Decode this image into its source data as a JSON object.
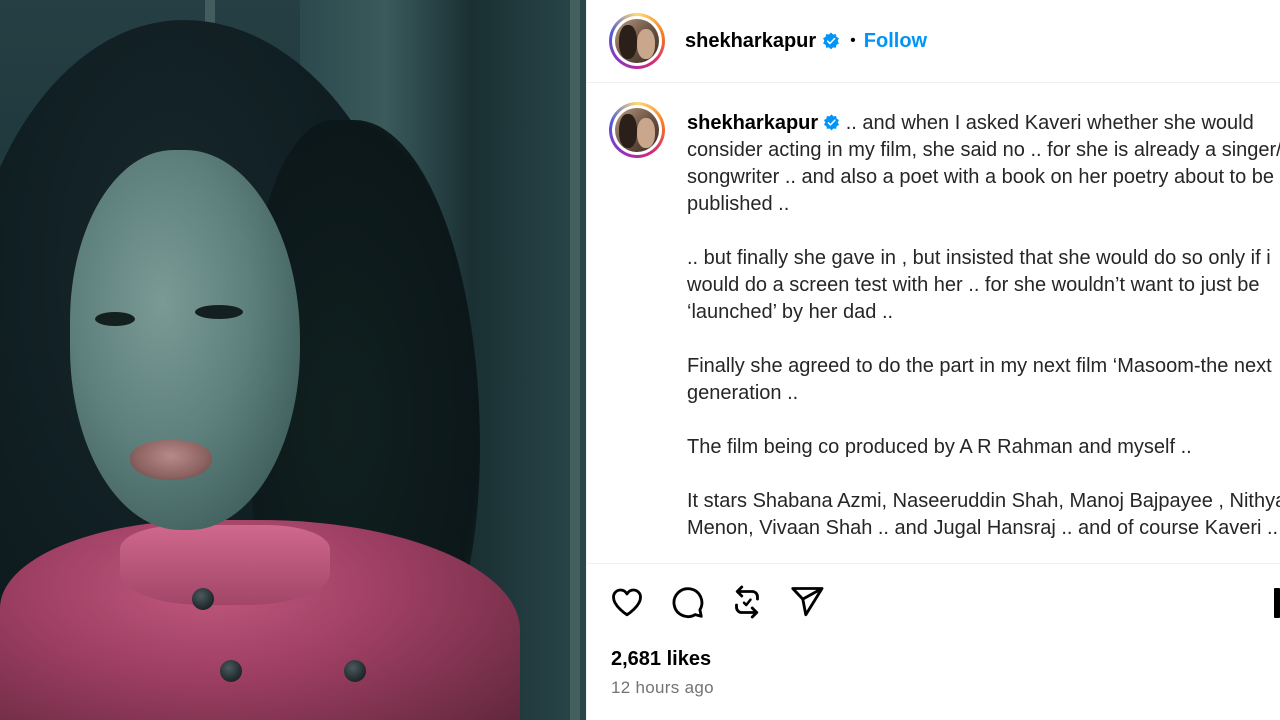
{
  "post": {
    "username": "shekharkapur",
    "separator": "•",
    "follow_label": "Follow",
    "caption_username": "shekharkapur",
    "caption": " .. and when I asked Kaveri whether she would consider acting in my film, she said no .. for she is already a singer/ songwriter .. and also a poet with a book on her poetry about to be published ..\n\n.. but finally she gave in , but insisted that she would do so only if i would do a screen test with her .. for she wouldn’t want to just be ‘launched’ by her dad ..\n\nFinally she agreed to do the part in my next film ‘Masoom-the next generation ..\n\nThe film being co produced by A R Rahman and myself ..\n\nIt stars Shabana Azmi, Naseeruddin Shah, Manoj Bajpayee , Nithya Menon, Vivaan Shah .. and Jugal Hansraj .. and of course Kaveri ..",
    "likes": "2,681 likes",
    "time": "12 hours ago"
  },
  "icons": {
    "like": "heart-icon",
    "comment": "comment-icon",
    "repost": "repost-icon",
    "share": "send-icon",
    "save": "bookmark-icon",
    "verified": "verified-badge-icon"
  },
  "colors": {
    "follow": "#0095f6",
    "verified": "#0095f6",
    "muted": "#737373"
  }
}
